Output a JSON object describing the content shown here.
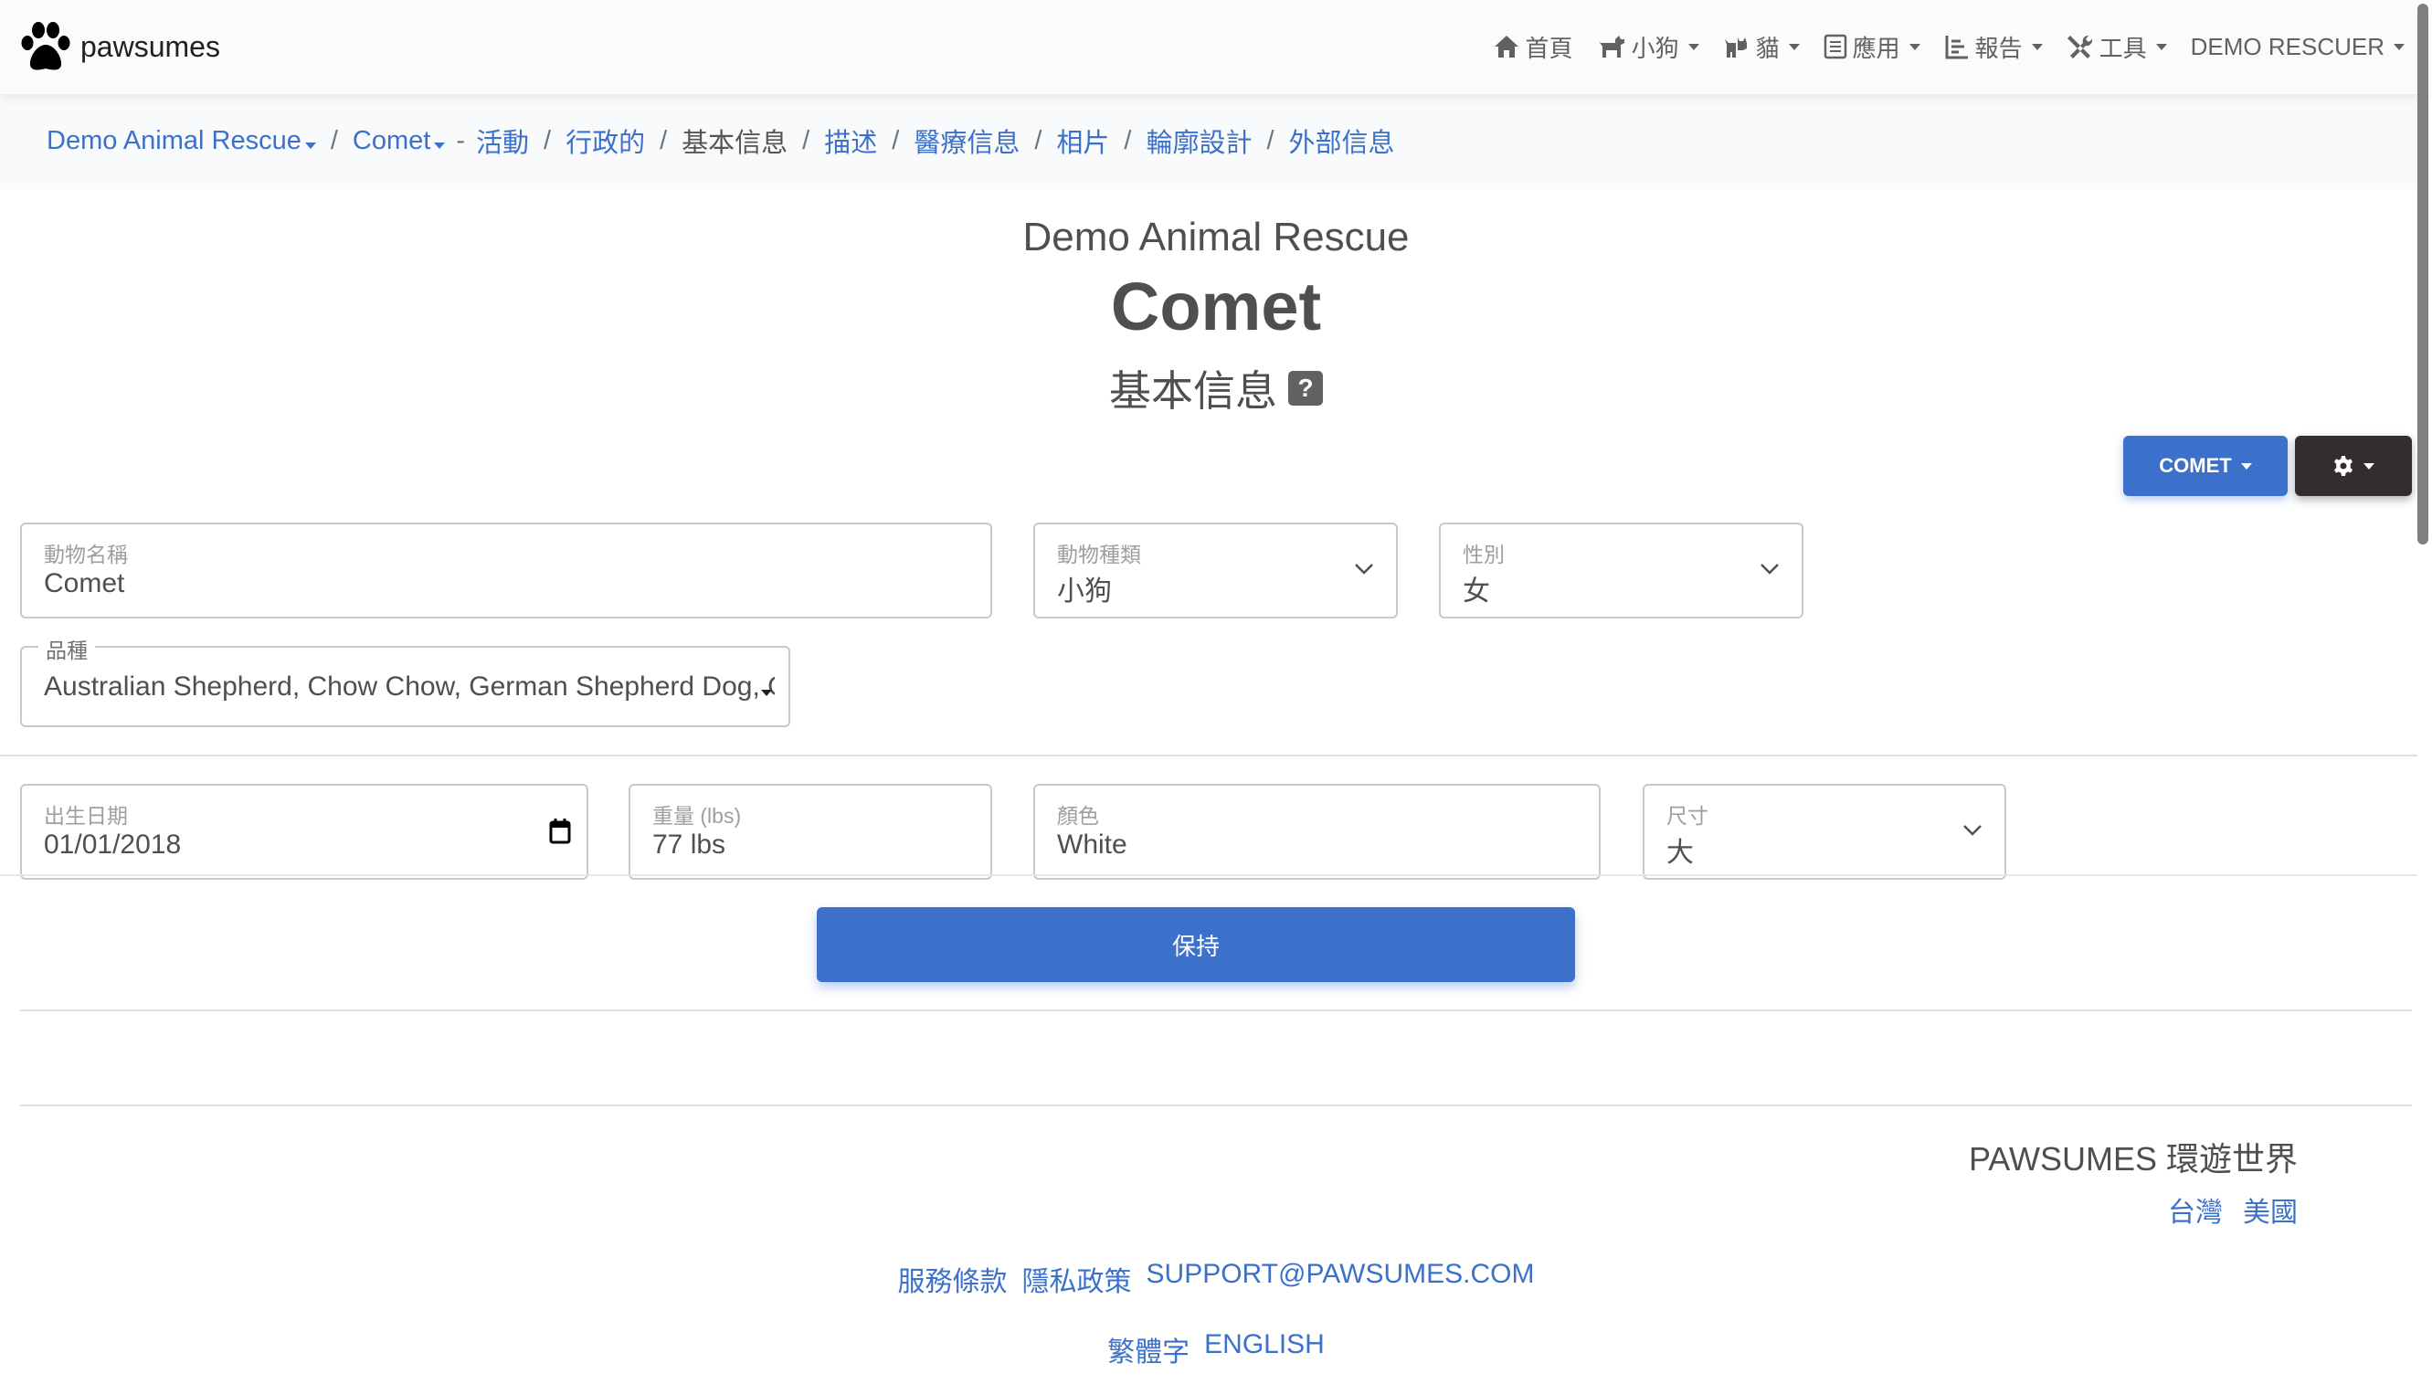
{
  "brand": {
    "name": "pawsumes",
    "logo_icon": "paw-icon"
  },
  "nav": {
    "items": [
      {
        "label": "首頁",
        "icon": "home-icon",
        "dropdown": false
      },
      {
        "label": "小狗",
        "icon": "dog-icon",
        "dropdown": true
      },
      {
        "label": "貓",
        "icon": "cat-icon",
        "dropdown": true
      },
      {
        "label": "應用",
        "icon": "clipboard-icon",
        "dropdown": true
      },
      {
        "label": "報告",
        "icon": "chart-icon",
        "dropdown": true
      },
      {
        "label": "工具",
        "icon": "tools-icon",
        "dropdown": true
      },
      {
        "label": "DEMO RESCUER",
        "icon": null,
        "dropdown": true
      }
    ]
  },
  "breadcrumb": {
    "org": "Demo Animal Rescue",
    "animal": "Comet",
    "dash": "-",
    "items": [
      {
        "label": "活動",
        "active": false
      },
      {
        "label": "行政的",
        "active": false
      },
      {
        "label": "基本信息",
        "active": true
      },
      {
        "label": "描述",
        "active": false
      },
      {
        "label": "醫療信息",
        "active": false
      },
      {
        "label": "相片",
        "active": false
      },
      {
        "label": "輪廓設計",
        "active": false
      },
      {
        "label": "外部信息",
        "active": false
      }
    ],
    "separator": "/"
  },
  "header": {
    "org_name": "Demo Animal Rescue",
    "animal_name": "Comet",
    "section": "基本信息",
    "help": "?"
  },
  "actions": {
    "animal_button": "COMET",
    "settings_icon": "gear-icon"
  },
  "form": {
    "animal_name": {
      "label": "動物名稱",
      "value": "Comet"
    },
    "animal_type": {
      "label": "動物種類",
      "value": "小狗"
    },
    "sex": {
      "label": "性別",
      "value": "女"
    },
    "breed": {
      "label": "品種",
      "value": "Australian Shepherd, Chow Chow, German Shepherd Dog, Grea"
    },
    "birth_date": {
      "label": "出生日期",
      "value": "01/01/2018"
    },
    "weight": {
      "label": "重量 (lbs)",
      "value": "77 lbs"
    },
    "color": {
      "label": "顏色",
      "value": "White"
    },
    "size": {
      "label": "尺寸",
      "value": "大"
    },
    "save_label": "保持"
  },
  "footer": {
    "title": "PAWSUMES 環遊世界",
    "countries": [
      "台灣",
      "美國"
    ],
    "links": [
      "服務條款",
      "隱私政策",
      "SUPPORT@PAWSUMES.COM"
    ],
    "languages": [
      "繁體字",
      "ENGLISH"
    ]
  },
  "colors": {
    "primary": "#3b71ca",
    "dark": "#332d2d",
    "text": "#4f4f4f"
  }
}
